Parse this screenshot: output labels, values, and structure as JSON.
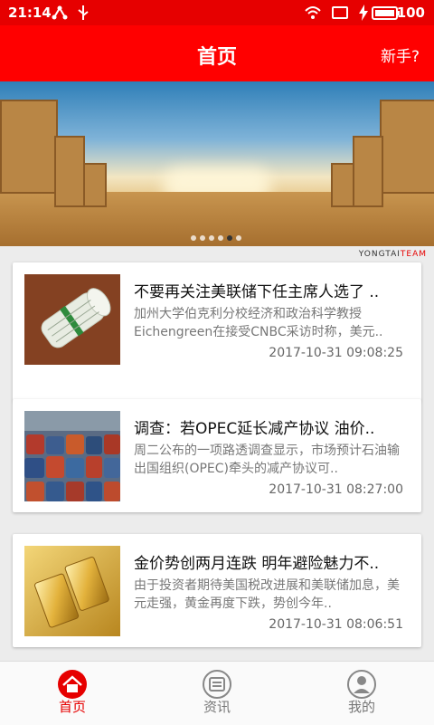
{
  "status_bar": {
    "time": "21:14",
    "battery": "100"
  },
  "header": {
    "title": "首页",
    "help_link": "新手?"
  },
  "banner": {
    "watermark_main": "YONGTAI",
    "watermark_accent": "TEAM",
    "slide_count": 6,
    "active_slide": 5
  },
  "news": [
    {
      "title": "不要再关注美联储下任主席人选了 ..",
      "summary": "加州大学伯克利分校经济和政治科学教授Eichengreen在接受CNBC采访时称，美元..",
      "date": "2017-10-31 09:08:25",
      "thumb": "cash-roll"
    },
    {
      "title": "调查：若OPEC延长减产协议 油价..",
      "summary": "周二公布的一项路透调查显示，市场预计石油输出国组织(OPEC)牵头的减产协议可..",
      "date": "2017-10-31 08:27:00",
      "thumb": "oil-barrels"
    },
    {
      "title": "金价势创两月连跌 明年避险魅力不..",
      "summary": "由于投资者期待美国税改进展和美联储加息，美元走强，黄金再度下跌，势创今年..",
      "date": "2017-10-31 08:06:51",
      "thumb": "gold-bars"
    }
  ],
  "tabs": [
    {
      "label": "首页",
      "icon": "home-icon",
      "active": true
    },
    {
      "label": "资讯",
      "icon": "news-icon",
      "active": false
    },
    {
      "label": "我的",
      "icon": "profile-icon",
      "active": false
    }
  ],
  "colors": {
    "primary": "#ff0000",
    "status": "#e60000",
    "active_tab": "#e60000"
  }
}
